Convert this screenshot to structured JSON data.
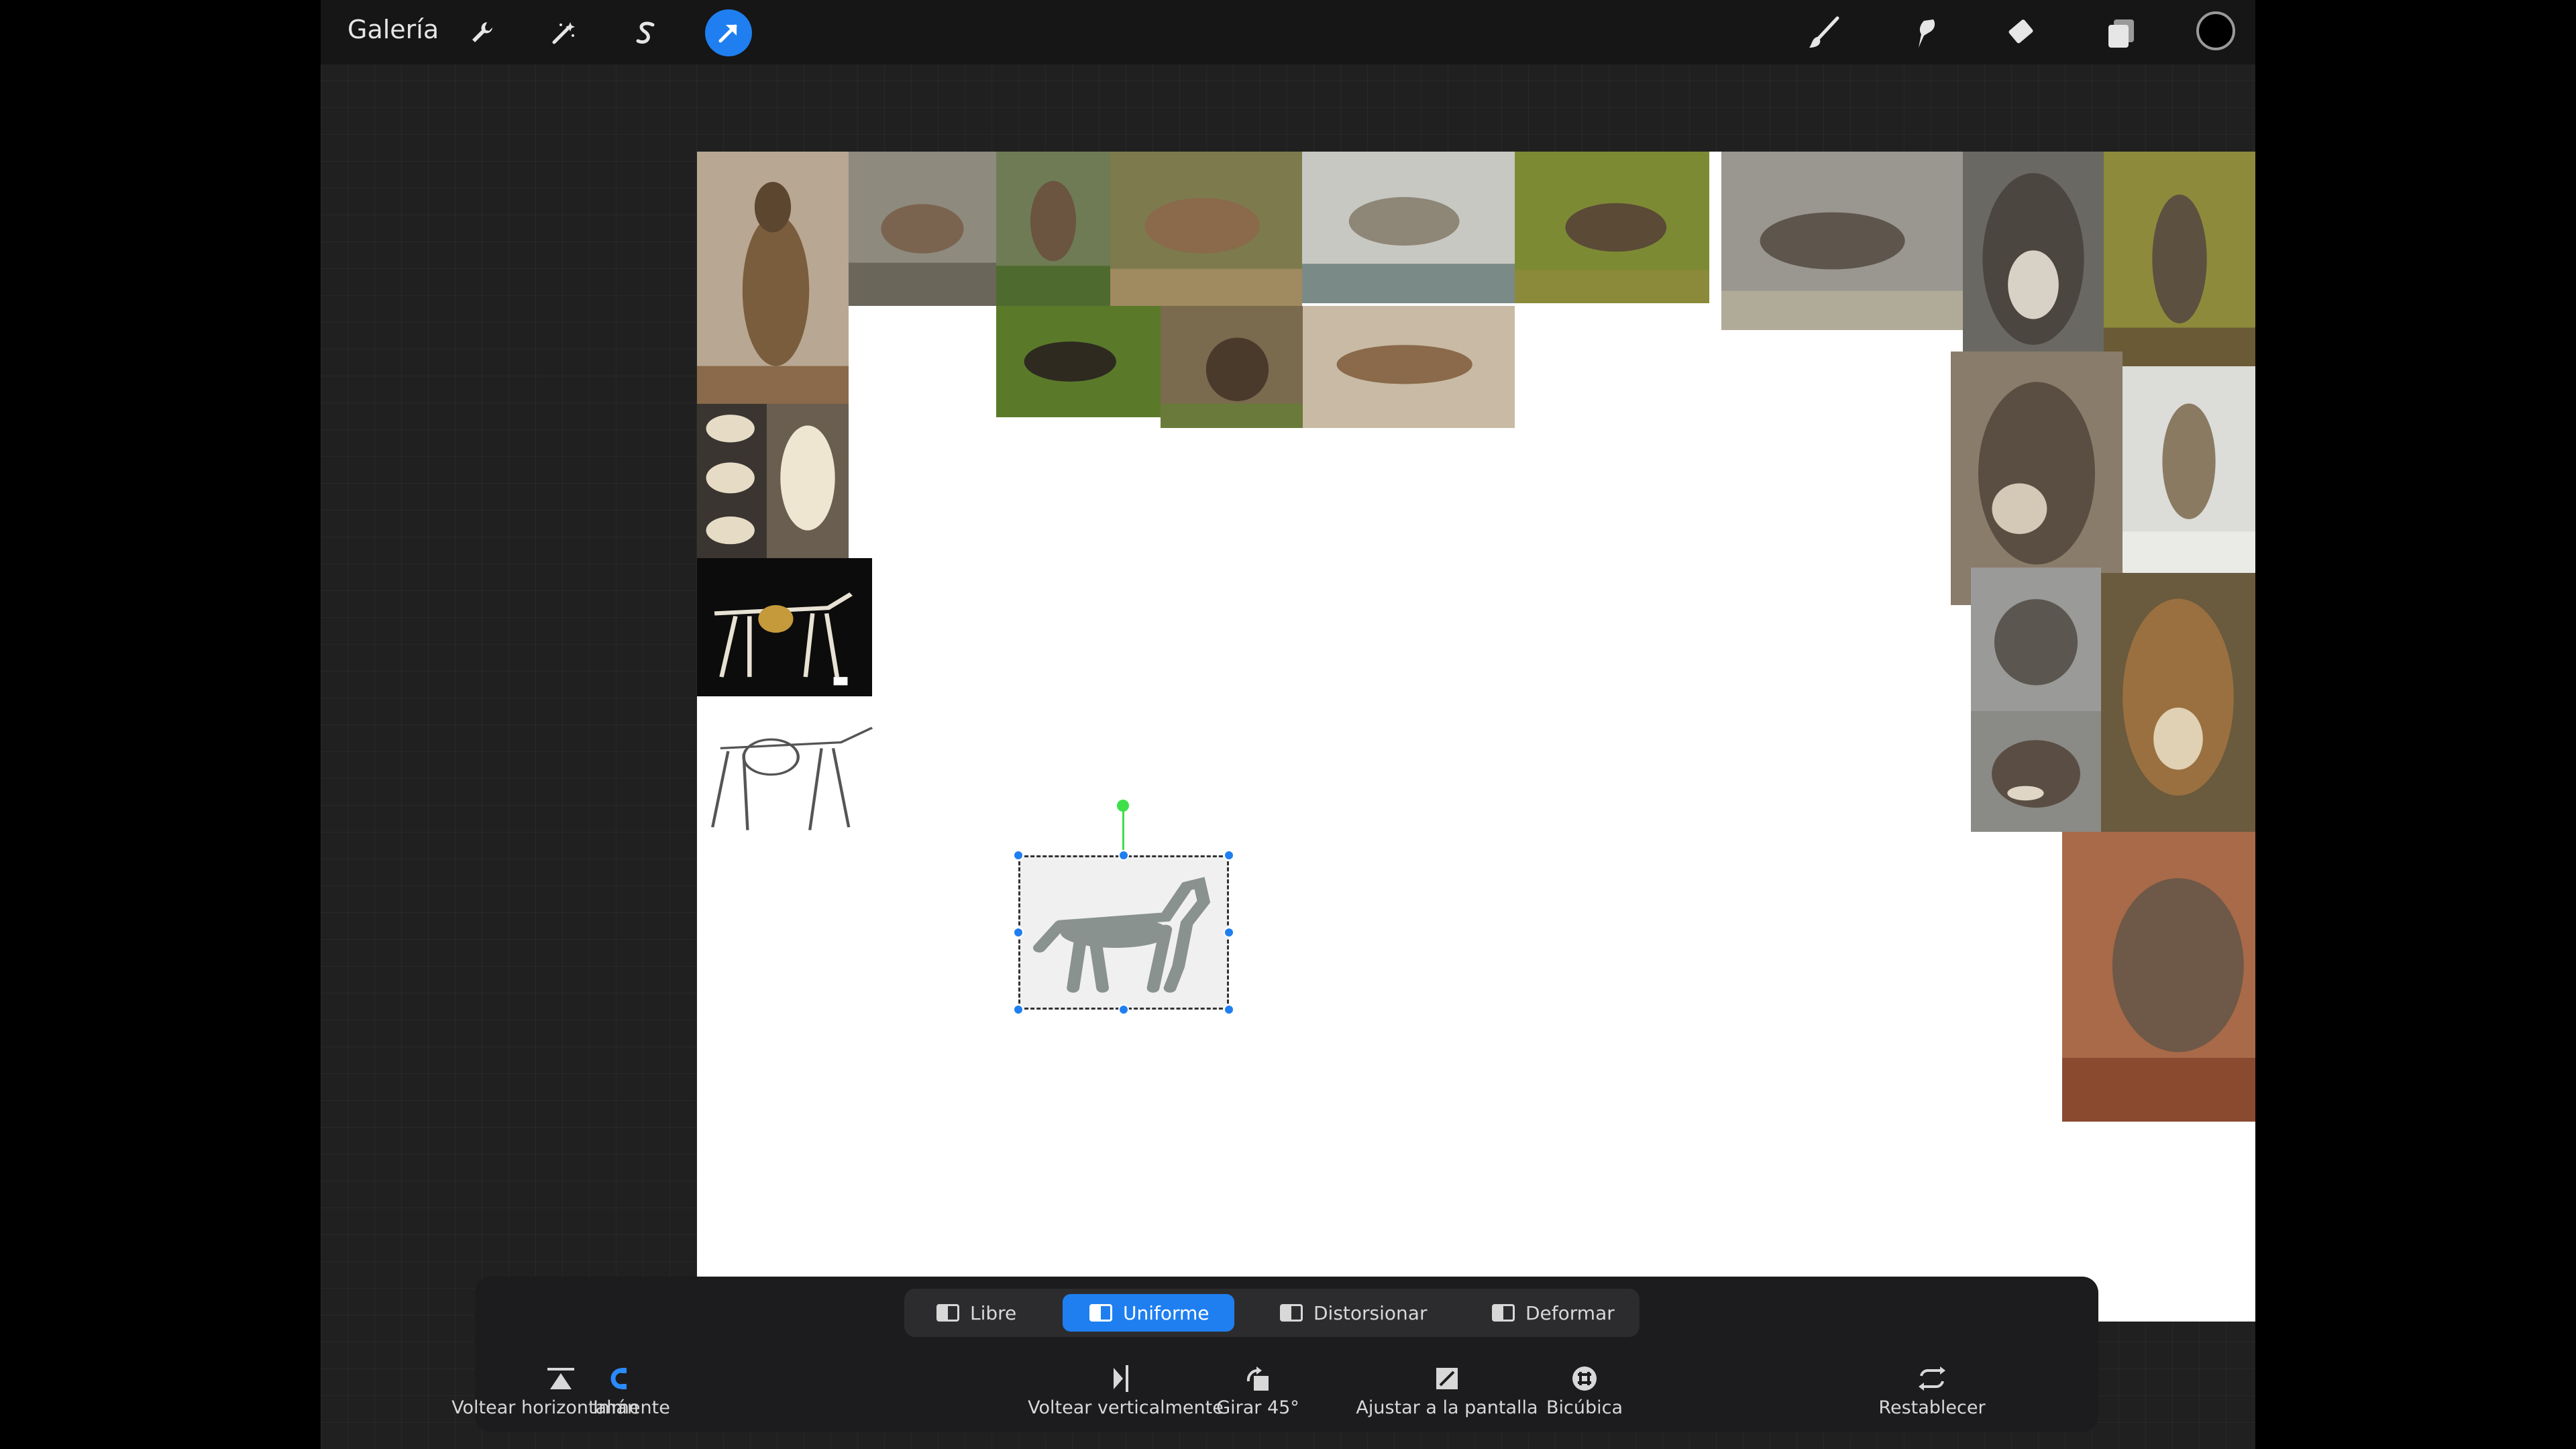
{
  "topbar": {
    "gallery_label": "Galería",
    "left_tools": [
      {
        "name": "wrench-icon",
        "active": false
      },
      {
        "name": "magic-wand-icon",
        "active": false
      },
      {
        "name": "selection-s-icon",
        "active": false
      },
      {
        "name": "transform-arrow-icon",
        "active": true
      }
    ],
    "right_tools": [
      "brush-icon",
      "smudge-icon",
      "eraser-icon",
      "layers-icon"
    ],
    "current_color": "#000000",
    "accent": "#1f7ff0"
  },
  "canvas": {
    "background": "#ffffff",
    "images": [
      {
        "name": "wolf-photo"
      },
      {
        "name": "skull-photo"
      },
      {
        "name": "skeleton-photo"
      },
      {
        "name": "skeleton-drawing"
      },
      {
        "name": "dog-anatomy-model"
      }
    ]
  },
  "bottom_panel": {
    "modes": [
      {
        "label": "Libre",
        "active": false
      },
      {
        "label": "Uniforme",
        "active": true
      },
      {
        "label": "Distorsionar",
        "active": false
      },
      {
        "label": "Deformar",
        "active": false
      }
    ],
    "actions": [
      {
        "label": "Imán",
        "icon": "magnet-icon",
        "active": true
      },
      {
        "label": "Voltear horizontalmente",
        "icon": "flip-horizontal-icon",
        "active": false
      },
      {
        "label": "Voltear verticalmente",
        "icon": "flip-vertical-icon",
        "active": false
      },
      {
        "label": "Girar 45°",
        "icon": "rotate-icon",
        "active": false
      },
      {
        "label": "Ajustar a la pantalla",
        "icon": "fit-screen-icon",
        "active": false
      },
      {
        "label": "Bicúbica",
        "icon": "bicubic-icon",
        "active": false
      },
      {
        "label": "Restablecer",
        "icon": "reset-icon",
        "active": false
      }
    ]
  }
}
